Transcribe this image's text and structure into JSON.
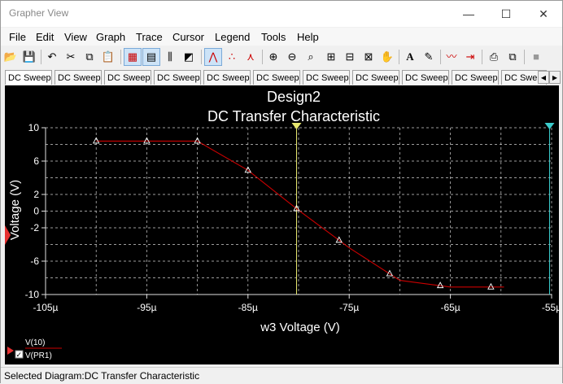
{
  "window": {
    "title": "Grapher View",
    "minimize": "—",
    "maximize": "☐",
    "close": "✕"
  },
  "menu": [
    "File",
    "Edit",
    "View",
    "Graph",
    "Trace",
    "Cursor",
    "Legend",
    "Tools",
    "Help"
  ],
  "toolbar": [
    {
      "icon": "open-folder-icon",
      "glyph": "📂"
    },
    {
      "icon": "save-icon",
      "glyph": "💾"
    },
    {
      "icon": "undo-icon",
      "glyph": "↶"
    },
    {
      "icon": "cut-icon",
      "glyph": "✂"
    },
    {
      "icon": "copy-icon",
      "glyph": "⧉"
    },
    {
      "icon": "paste-icon",
      "glyph": "📋"
    },
    {
      "icon": "grid-icon",
      "glyph": "▦"
    },
    {
      "icon": "legend-icon",
      "glyph": "▤"
    },
    {
      "icon": "cursors-icon",
      "glyph": "⫼"
    },
    {
      "icon": "black-white-icon",
      "glyph": "◩"
    },
    {
      "icon": "line-trace-icon",
      "glyph": "⋀"
    },
    {
      "icon": "points-trace-icon",
      "glyph": "∴"
    },
    {
      "icon": "line-points-icon",
      "glyph": "⋏"
    },
    {
      "icon": "zoom-in-icon",
      "glyph": "⊕"
    },
    {
      "icon": "zoom-out-icon",
      "glyph": "⊖"
    },
    {
      "icon": "zoom-area-icon",
      "glyph": "⌕"
    },
    {
      "icon": "zoom-x-icon",
      "glyph": "⊞"
    },
    {
      "icon": "zoom-y-icon",
      "glyph": "⊟"
    },
    {
      "icon": "zoom-full-icon",
      "glyph": "⊠"
    },
    {
      "icon": "pan-hand-icon",
      "glyph": "✋"
    },
    {
      "icon": "text-icon",
      "glyph": "A"
    },
    {
      "icon": "label-icon",
      "glyph": "✎"
    },
    {
      "icon": "trace-properties-icon",
      "glyph": "〰"
    },
    {
      "icon": "export-icon",
      "glyph": "⇥"
    },
    {
      "icon": "print-icon",
      "glyph": "⎙"
    },
    {
      "icon": "overlay-icon",
      "glyph": "⧉"
    },
    {
      "icon": "stop-icon",
      "glyph": "■"
    }
  ],
  "tabs": [
    "DC Sweep",
    "DC Sweep",
    "DC Sweep",
    "DC Sweep",
    "DC Sweep",
    "DC Sweep",
    "DC Sweep",
    "DC Sweep",
    "DC Sweep",
    "DC Sweep",
    "DC Swe"
  ],
  "tab_nav": {
    "left": "◀",
    "right": "▶"
  },
  "chart_data": {
    "type": "line",
    "title": "Design2",
    "subtitle": "DC Transfer Characteristic",
    "xlabel": "w3 Voltage (V)",
    "ylabel": "Voltage (V)",
    "xlim": [
      -105,
      -55
    ],
    "ylim": [
      -10,
      10
    ],
    "xticks": [
      -105,
      -95,
      -85,
      -75,
      -65,
      -55
    ],
    "xtick_labels": [
      "-105µ",
      "-95µ",
      "-85µ",
      "-75µ",
      "-65µ",
      "-55µ"
    ],
    "yticks": [
      10,
      6,
      2,
      0,
      -2,
      -6,
      -10
    ],
    "ytick_labels": [
      "10",
      "6",
      "2",
      "0",
      "-2",
      "-6",
      "-10"
    ],
    "grid": true,
    "series": [
      {
        "name": "V(10)",
        "color": "#cc0000",
        "x": [
          -100,
          -95,
          -90,
          -85,
          -80,
          -75,
          -70,
          -65,
          -60,
          -59.7
        ],
        "y": [
          8.4,
          8.4,
          8.4,
          4.9,
          0.1,
          -4.4,
          -8.3,
          -9.1,
          -9.1,
          -9.1
        ],
        "markers": [
          -100,
          -95,
          -90,
          -85,
          -80.2,
          -76,
          -71,
          -66,
          -61
        ]
      },
      {
        "name": "V(PR1)",
        "color": "#cc0000",
        "x": [],
        "y": []
      }
    ],
    "cursors": [
      {
        "name": "cursor-1",
        "x": -80.2,
        "color": "#e8e870"
      },
      {
        "name": "cursor-2",
        "x": -55.2,
        "color": "#3ccccc"
      }
    ]
  },
  "legend": [
    "V(10)",
    "V(PR1)"
  ],
  "status": "Selected Diagram:DC Transfer Characteristic"
}
